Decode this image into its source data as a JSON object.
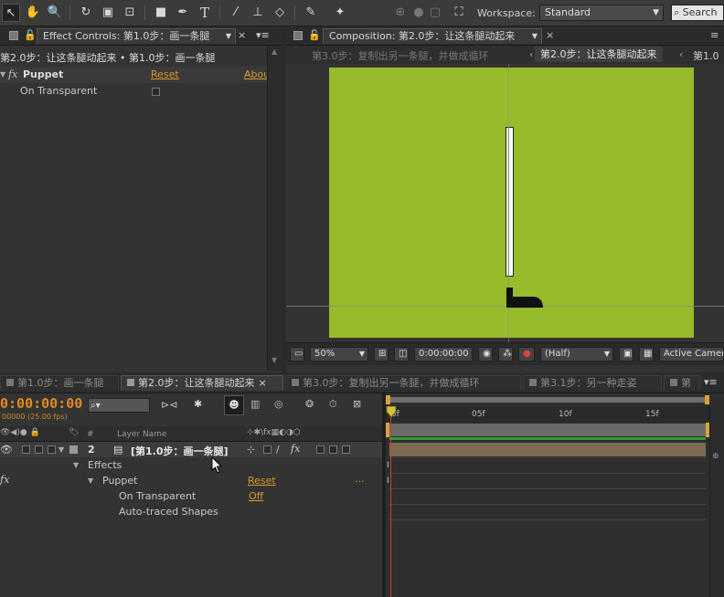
{
  "toolbar": {
    "workspace_label": "Workspace:",
    "workspace_value": "Standard",
    "search_placeholder": "Search",
    "tools": [
      "selection-tool",
      "hand-tool",
      "zoom-tool",
      "rotate-tool",
      "camera-tool",
      "pan-behind-tool",
      "rectangle-tool",
      "pen-tool",
      "type-tool",
      "brush-tool",
      "clone-stamp-tool",
      "eraser-tool",
      "roto-brush-tool",
      "puppet-pin-tool"
    ]
  },
  "effect_controls": {
    "tab_label": "Effect Controls: 第1.0步：画一条腿",
    "breadcrumb": "第2.0步：让这条腿动起来 • 第1.0步：画一条腿",
    "effect_name": "Puppet",
    "fx_glyph": "fx",
    "reset_label": "Reset",
    "about_label": "Abou",
    "property_label": "On Transparent"
  },
  "composition": {
    "tab_label": "Composition: 第2.0步：让这条腿动起来",
    "nav_tabs": [
      "第3.0步：复制出另一条腿，并做成循环",
      "第2.0步：让这条腿动起来",
      "第1.0"
    ],
    "zoom_value": "50%",
    "timecode": "0:00:00:00",
    "resolution": "(Half)",
    "camera": "Active Camera"
  },
  "timeline": {
    "tabs": [
      "第1.0步：画一条腿",
      "第2.0步：让这条腿动起来",
      "第3.0步：复制出另一条腿，并做成循环",
      "第3.1步：另一种走姿",
      "第"
    ],
    "current_time": "0:00:00:00",
    "fps_label": "00000 (25.00 fps)",
    "search_placeholder": "",
    "layer_name_header": "Layer Name",
    "hash_header": "#",
    "layer_number": "2",
    "layer_name": "[第1.0步：画一条腿]",
    "effects_label": "Effects",
    "puppet_label": "Puppet",
    "puppet_reset": "Reset",
    "puppet_dots": "...",
    "on_transparent_label": "On Transparent",
    "on_transparent_value": "Off",
    "auto_traced_label": "Auto-traced Shapes",
    "fx_glyph": "fx",
    "ruler_labels": [
      "0f",
      "05f",
      "10f",
      "15f"
    ]
  },
  "colors": {
    "comp_bg": "#96bb2b",
    "accent": "#d99a2b",
    "work_area": "#6b6b6b",
    "green_bar": "#2aa033"
  }
}
